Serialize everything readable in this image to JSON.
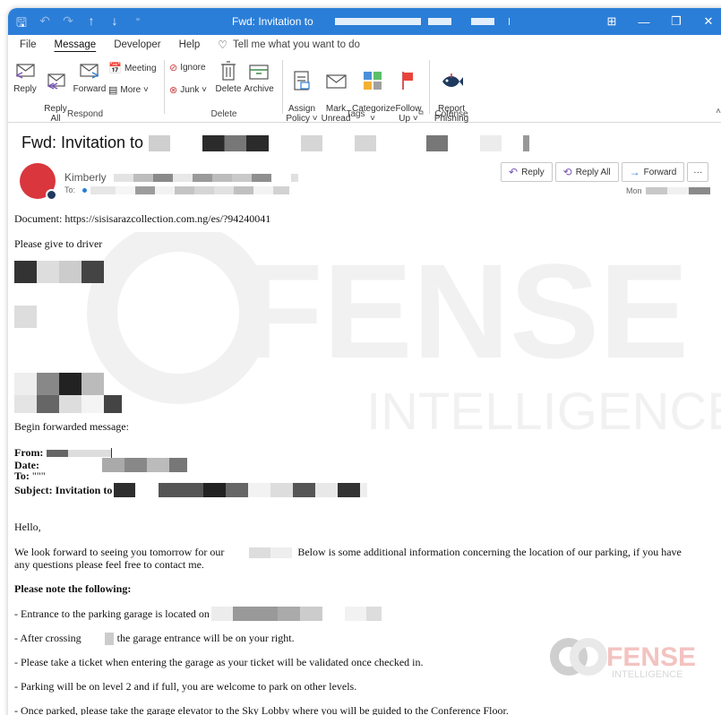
{
  "window": {
    "title": "Fwd: Invitation to",
    "controls": [
      "▭",
      "—",
      "▢",
      "✕"
    ]
  },
  "quick_access": [
    "save-icon",
    "undo-icon",
    "redo-icon",
    "up-icon",
    "down-icon",
    "customize-icon"
  ],
  "menu": {
    "items": [
      "File",
      "Message",
      "Developer",
      "Help"
    ],
    "active": "Message",
    "tell_me": "Tell me what you want to do"
  },
  "ribbon": {
    "respond": {
      "name": "Respond",
      "reply": "Reply",
      "reply_all": "Reply\nAll",
      "forward": "Forward",
      "meeting": "Meeting",
      "more": "More ˅"
    },
    "delete": {
      "name": "Delete",
      "ignore": "Ignore",
      "junk": "Junk ˅",
      "delete": "Delete",
      "archive": "Archive"
    },
    "tags": {
      "name": "Tags",
      "assign_policy": "Assign\nPolicy ˅",
      "mark_unread": "Mark\nUnread",
      "categorize": "Categorize\n˅",
      "follow_up": "Follow\nUp ˅"
    },
    "cofense": {
      "name": "Cofense",
      "report_phishing": "Report\nPhishing"
    }
  },
  "message": {
    "subject_prefix": "Fwd: Invitation to",
    "sender_name": "Kimberly",
    "to_label": "To:",
    "date_prefix": "Mon",
    "actions": {
      "reply": "Reply",
      "reply_all": "Reply All",
      "forward": "Forward",
      "more": "···"
    }
  },
  "body": {
    "document_line": "Document: https://sisisarazcollection.com.ng/es/?94240041",
    "give_driver": "Please give to driver",
    "begin_forwarded": "Begin forwarded message:",
    "from_label": "From:",
    "date_label": "Date:",
    "to_label": "To:",
    "to_value": "\"\"\"",
    "subject_label": "Subject: Invitation to",
    "hello": "Hello,",
    "para1_start": "We look forward to seeing you tomorrow for our",
    "para1_end": "Below is some additional information concerning the location of our parking, if you have",
    "para1_line2": "any questions please feel free to contact me.",
    "note_heading": "Please note the following:",
    "bullet1": "-  Entrance to the parking garage is located on",
    "bullet2_start": "-  After crossing",
    "bullet2_end": "the garage entrance will be on your right.",
    "bullet3": "-  Please take a ticket when entering the garage as your ticket will be validated once checked in.",
    "bullet4": "-  Parking will be on level 2 and if full, you are welcome to park on other levels.",
    "bullet5": "-  Once parked, please take the garage elevator to the Sky Lobby where you will be guided to the Conference Floor."
  },
  "watermark": {
    "brand": "FENSE",
    "sub": "INTELLIGENCE"
  },
  "colors": {
    "titlebar": "#2b7ed8",
    "avatar": "#d9363e",
    "accent": "#2b7ed8",
    "brand_red": "#e8443a"
  }
}
